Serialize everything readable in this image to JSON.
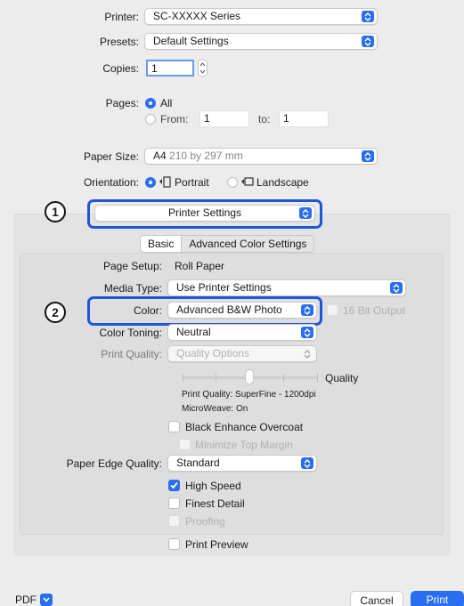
{
  "printer": {
    "label": "Printer:",
    "value": "SC-XXXXX Series"
  },
  "presets": {
    "label": "Presets:",
    "value": "Default Settings"
  },
  "copies": {
    "label": "Copies:",
    "value": "1"
  },
  "pages": {
    "label": "Pages:",
    "all": "All",
    "from": "From:",
    "from_value": "1",
    "to": "to:",
    "to_value": "1"
  },
  "paper_size": {
    "label": "Paper Size:",
    "size": "A4",
    "dimensions": "210 by 297 mm"
  },
  "orientation": {
    "label": "Orientation:",
    "portrait": "Portrait",
    "landscape": "Landscape"
  },
  "callouts": {
    "one": "1",
    "two": "2"
  },
  "section_menu": {
    "value": "Printer Settings"
  },
  "tabs": {
    "basic": "Basic",
    "advanced": "Advanced Color Settings"
  },
  "settings": {
    "page_setup_label": "Page Setup:",
    "page_setup_value": "Roll Paper",
    "media_type_label": "Media Type:",
    "media_type_value": "Use Printer Settings",
    "color_label": "Color:",
    "color_value": "Advanced B&W Photo",
    "bit16": "16 Bit Output",
    "color_toning_label": "Color Toning:",
    "color_toning_value": "Neutral",
    "print_quality_label": "Print Quality:",
    "print_quality_value": "Quality Options",
    "quality_slider_label": "Quality",
    "quality_info": "Print Quality: SuperFine - 1200dpi",
    "microweave": "MicroWeave: On",
    "black_enhance": "Black Enhance Overcoat",
    "minimize_top": "Minimize Top Margin",
    "edge_quality_label": "Paper Edge Quality:",
    "edge_quality_value": "Standard",
    "high_speed": "High Speed",
    "finest_detail": "Finest Detail",
    "proofing": "Proofing",
    "print_preview": "Print Preview"
  },
  "footer": {
    "pdf": "PDF",
    "cancel": "Cancel",
    "print": "Print"
  },
  "colors": {
    "accent": "#2a6ef0",
    "highlight": "#1f56d6"
  }
}
